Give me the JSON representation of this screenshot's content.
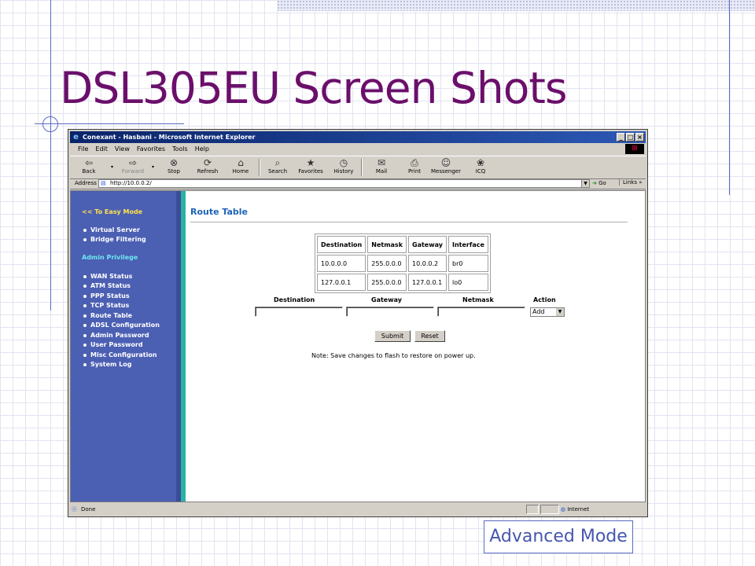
{
  "slide": {
    "title": "DSL305EU Screen Shots",
    "caption": "Advanced Mode"
  },
  "browser": {
    "window_title": "Conexant - Hasbani - Microsoft Internet Explorer",
    "menu": [
      "File",
      "Edit",
      "View",
      "Favorites",
      "Tools",
      "Help"
    ],
    "toolbar": [
      "Back",
      "Forward",
      "Stop",
      "Refresh",
      "Home",
      "Search",
      "Favorites",
      "History",
      "Mail",
      "Print",
      "Messenger",
      "ICQ"
    ],
    "address_label": "Address",
    "address_value": "http://10.0.0.2/",
    "go_label": "Go",
    "links_label": "Links »",
    "status_text": "Done",
    "zone_text": "Internet"
  },
  "sidebar": {
    "easy_mode": "<< To Easy Mode",
    "group1": [
      "Virtual Server",
      "Bridge Filtering"
    ],
    "admin_heading": "Admin Privilege",
    "group2": [
      "WAN Status",
      "ATM Status",
      "PPP Status",
      "TCP Status",
      "Route Table",
      "ADSL Configuration",
      "Admin Password",
      "User Password",
      "Misc Configuration",
      "System Log"
    ]
  },
  "page": {
    "heading": "Route Table",
    "table": {
      "headers": [
        "Destination",
        "Netmask",
        "Gateway",
        "Interface"
      ],
      "rows": [
        [
          "10.0.0.0",
          "255.0.0.0",
          "10.0.0.2",
          "br0"
        ],
        [
          "127.0.0.1",
          "255.0.0.0",
          "127.0.0.1",
          "lo0"
        ]
      ]
    },
    "form": {
      "labels": {
        "destination": "Destination",
        "gateway": "Gateway",
        "netmask": "Netmask",
        "action": "Action"
      },
      "destination_value": "",
      "gateway_value": "",
      "netmask_value": "",
      "action_selected": "Add"
    },
    "submit_label": "Submit",
    "reset_label": "Reset",
    "note": "Note: Save changes to flash to restore on power up."
  }
}
